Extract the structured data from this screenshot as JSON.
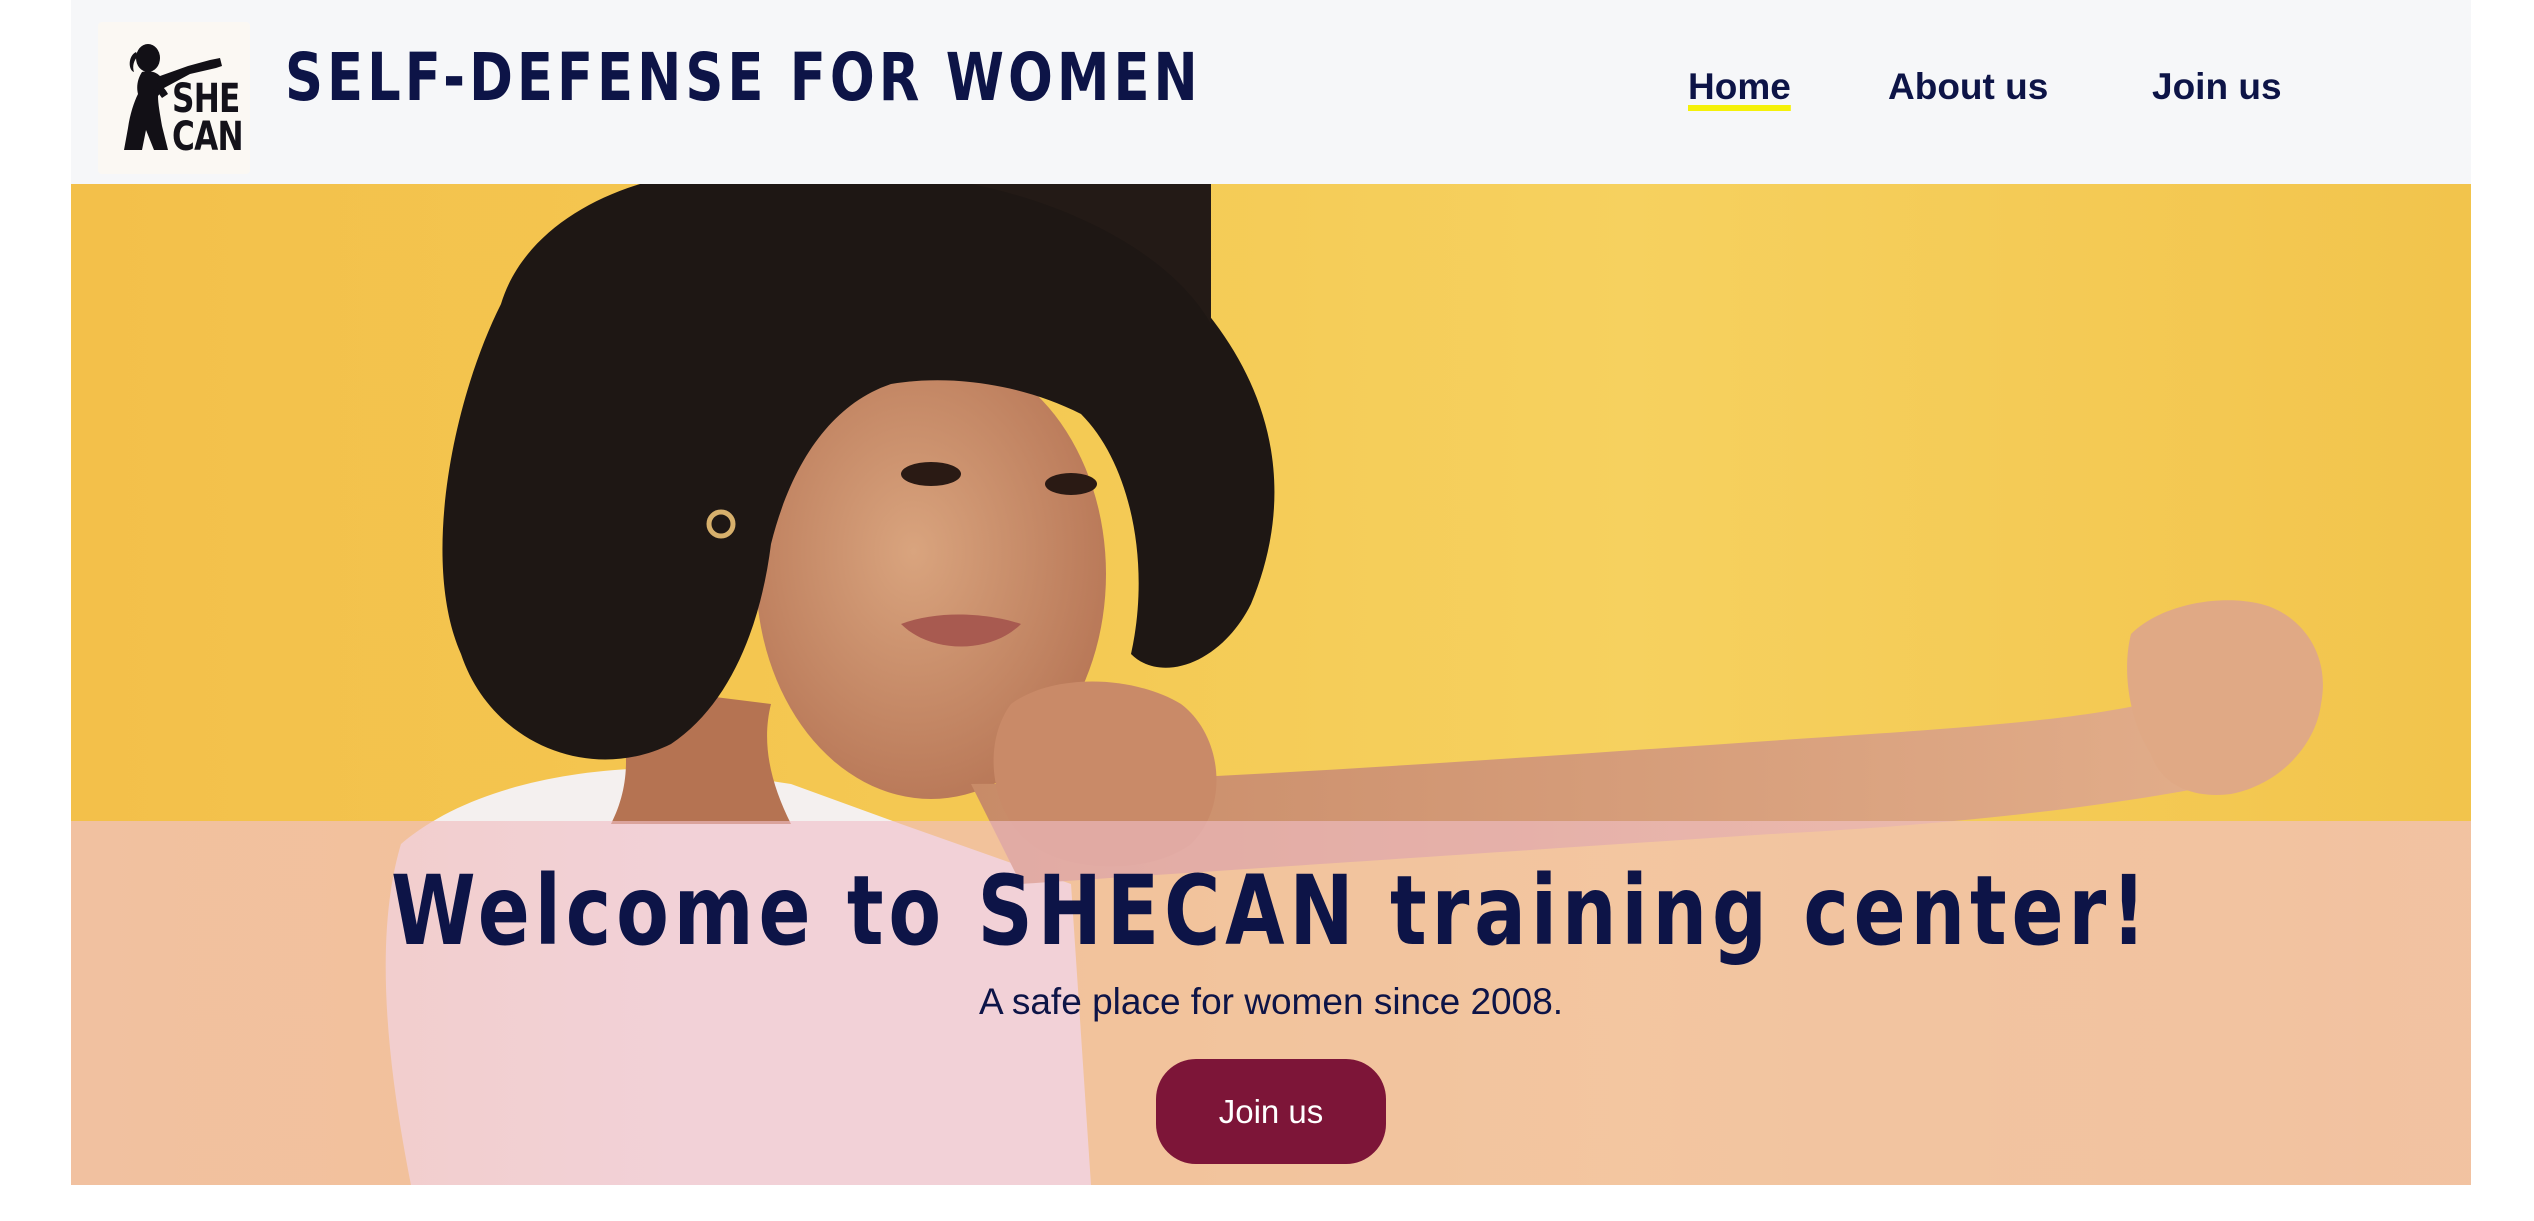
{
  "header": {
    "logo": {
      "icon": "boxer-silhouette-icon",
      "text_line1": "SHE",
      "text_line2": "CAN"
    },
    "site_title": "SELF-DEFENSE FOR WOMEN",
    "nav": [
      {
        "label": "Home",
        "active": true
      },
      {
        "label": "About us",
        "active": false
      },
      {
        "label": "Join us",
        "active": false
      }
    ]
  },
  "hero": {
    "image": "woman-boxing-stance-photo",
    "heading": "Welcome to SHECAN training center!",
    "tagline": "A safe place for women since 2008.",
    "cta_label": "Join us"
  },
  "colors": {
    "navy": "#0d1447",
    "header_bg": "#f6f7f9",
    "hero_bg": "#f4c953",
    "cta_bg": "#7d1538",
    "active_underline": "#f5f10a"
  }
}
